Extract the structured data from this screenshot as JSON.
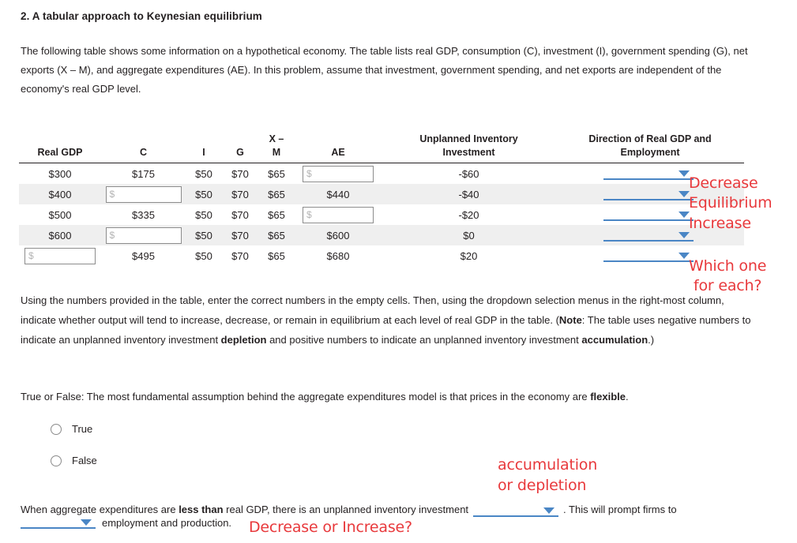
{
  "question": {
    "title": "2. A tabular approach to Keynesian equilibrium",
    "intro": "The following table shows some information on a hypothetical economy. The table lists real GDP, consumption (C), investment (I), government spending (G), net exports (X – M), and aggregate expenditures (AE). In this problem, assume that investment, government spending, and net exports are independent of the economy's real GDP level."
  },
  "table": {
    "headers": {
      "real_gdp": "Real GDP",
      "c": "C",
      "i": "I",
      "g": "G",
      "xm_line1": "X –",
      "xm_line2": "M",
      "ae": "AE",
      "ui_line1": "Unplanned Inventory",
      "ui_line2": "Investment",
      "dir_line1": "Direction of Real GDP and",
      "dir_line2": "Employment"
    },
    "input_placeholder": "$",
    "rows": [
      {
        "real_gdp": "$300",
        "real_gdp_input": false,
        "c": "$175",
        "c_input": false,
        "i": "$50",
        "g": "$70",
        "xm": "$65",
        "ae": "",
        "ae_input": true,
        "ui": "-$60",
        "shaded": false
      },
      {
        "real_gdp": "$400",
        "real_gdp_input": false,
        "c": "",
        "c_input": true,
        "i": "$50",
        "g": "$70",
        "xm": "$65",
        "ae": "$440",
        "ae_input": false,
        "ui": "-$40",
        "shaded": true
      },
      {
        "real_gdp": "$500",
        "real_gdp_input": false,
        "c": "$335",
        "c_input": false,
        "i": "$50",
        "g": "$70",
        "xm": "$65",
        "ae": "",
        "ae_input": true,
        "ui": "-$20",
        "shaded": false
      },
      {
        "real_gdp": "$600",
        "real_gdp_input": false,
        "c": "",
        "c_input": true,
        "i": "$50",
        "g": "$70",
        "xm": "$65",
        "ae": "$600",
        "ae_input": false,
        "ui": "$0",
        "shaded": true
      },
      {
        "real_gdp": "",
        "real_gdp_input": true,
        "c": "$495",
        "c_input": false,
        "i": "$50",
        "g": "$70",
        "xm": "$65",
        "ae": "$680",
        "ae_input": false,
        "ui": "$20",
        "shaded": false
      }
    ]
  },
  "annotations": {
    "row1": "Decrease",
    "row2": "Equilibrium",
    "row3": "Increase",
    "row5_l1": "Which one",
    "row5_l2": "for each?",
    "bottom_l1": "accumulation",
    "bottom_l2": "or depletion",
    "bottom_last": "Decrease or Increase?"
  },
  "paragraphs": {
    "instructions_a": "Using the numbers provided in the table, enter the correct numbers in the empty cells. Then, using the dropdown selection menus in the right-most column, indicate whether output will tend to increase, decrease, or remain in equilibrium at each level of real GDP in the table. (",
    "instructions_note_bold": "Note",
    "instructions_b": ": The table uses negative numbers to indicate an unplanned inventory investment ",
    "instructions_bold_depletion": "depletion",
    "instructions_c": " and positive numbers to indicate an unplanned inventory investment ",
    "instructions_bold_accumulation": "accumulation",
    "instructions_d": ".)",
    "tf_a": "True or False: The most fundamental assumption behind the aggregate expenditures model is that prices in the economy are ",
    "tf_bold": "flexible",
    "tf_b": "."
  },
  "radios": {
    "true_label": "True",
    "false_label": "False"
  },
  "final_statement": {
    "a": "When aggregate expenditures are ",
    "bold1": "less than",
    "b": " real GDP, there is an unplanned inventory investment",
    "c": ". This will prompt firms to",
    "d": "employment and production."
  },
  "colors": {
    "accent_blue": "#4a86c5",
    "annotation_red": "#e8393c",
    "row_shade": "#efefef",
    "text": "#231f20"
  }
}
